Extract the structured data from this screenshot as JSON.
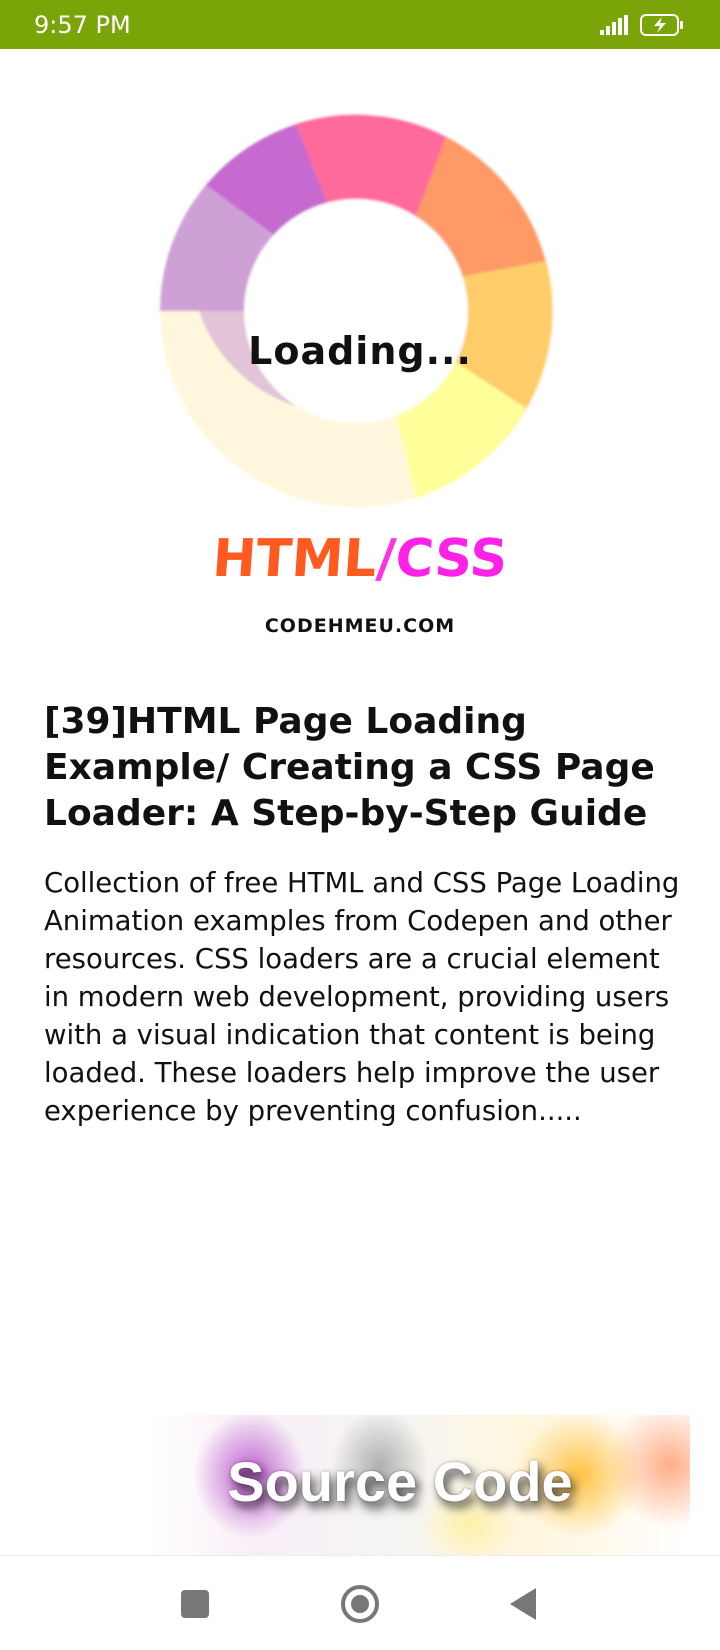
{
  "status_bar": {
    "time": "9:57 PM",
    "background_color": "#7ba408",
    "icons": [
      "signal-icon",
      "battery-charging-icon"
    ]
  },
  "hero": {
    "loader_text": "Loading...",
    "brand_html": "HTML",
    "brand_slash": "/",
    "brand_css": "CSS",
    "site_name": "CODEHMEU.COM",
    "colors": {
      "html": "#ff5a1f",
      "css": "#ff22e6",
      "ring": [
        "#c57ad6",
        "#ff6699",
        "#ff9966",
        "#ffcc66",
        "#ffff99",
        "#fff7dd"
      ]
    }
  },
  "article": {
    "title": "[39]HTML Page Loading Example/ Creating a CSS Page Loader: A Step-by-Step Guide",
    "body": "Collection of free HTML and CSS Page Loading Animation examples from Codepen and other resources. CSS loaders are a crucial element in modern web development, providing users with a visual indication that content is being loaded. These loaders help improve the user experience by preventing confusion....."
  },
  "source_button": {
    "label": "Source Code"
  },
  "nav_bar": {
    "icons": [
      "recent-apps-icon",
      "home-icon",
      "back-icon"
    ]
  }
}
